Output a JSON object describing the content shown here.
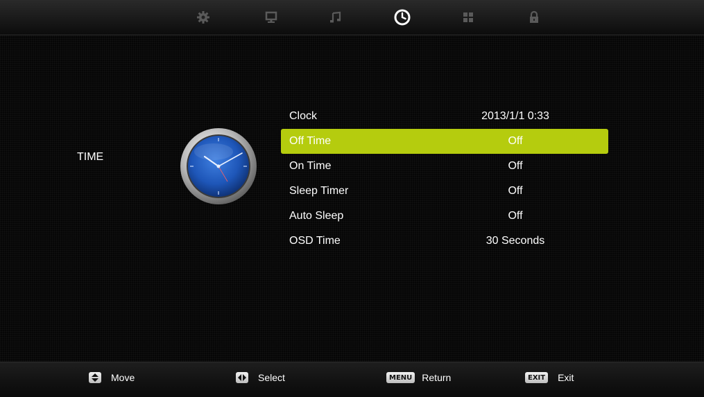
{
  "tabs": [
    {
      "icon": "gear-icon",
      "active": false
    },
    {
      "icon": "monitor-icon",
      "active": false
    },
    {
      "icon": "music-note-icon",
      "active": false
    },
    {
      "icon": "clock-icon",
      "active": true
    },
    {
      "icon": "grid-icon",
      "active": false
    },
    {
      "icon": "lock-icon",
      "active": false
    }
  ],
  "section": {
    "title": "TIME",
    "icon": "analog-clock-icon"
  },
  "menu": {
    "items": [
      {
        "label": "Clock",
        "value": "2013/1/1 0:33"
      },
      {
        "label": "Off Time",
        "value": "Off"
      },
      {
        "label": "On Time",
        "value": "Off"
      },
      {
        "label": "Sleep Timer",
        "value": "Off"
      },
      {
        "label": "Auto Sleep",
        "value": "Off"
      },
      {
        "label": "OSD Time",
        "value": "30 Seconds"
      }
    ],
    "selected_label": "Off Time"
  },
  "hints": {
    "move": {
      "key_icon": "up-down-arrows-icon",
      "label": "Move"
    },
    "select": {
      "key_icon": "left-right-arrows-icon",
      "label": "Select"
    },
    "return": {
      "key": "MENU",
      "label": "Return"
    },
    "exit": {
      "key": "EXIT",
      "label": "Exit"
    }
  },
  "colors": {
    "highlight": "#b5cc0e",
    "background": "#060606",
    "clock_face": "#1e56b8"
  }
}
